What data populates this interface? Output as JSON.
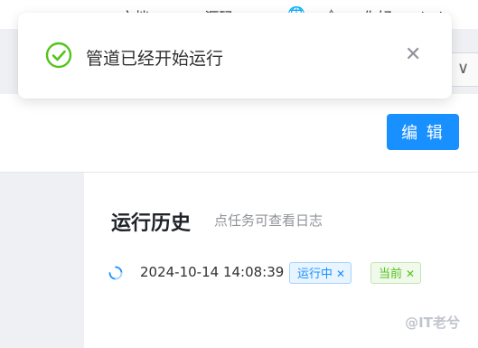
{
  "header": {
    "nav_doc": "文档",
    "nav_src": "源码",
    "nav_user": "你好，admin"
  },
  "toolbar": {
    "edit_label": "编 辑"
  },
  "history": {
    "title": "运行历史",
    "hint": "点任务可查看日志",
    "runs": [
      {
        "time": "2024-10-14 14:08:39",
        "status_tag": "运行中",
        "current_tag": "当前"
      }
    ]
  },
  "notification": {
    "message": "管道已经开始运行"
  },
  "watermark": "@IT老兮",
  "colors": {
    "primary": "#1890ff",
    "success": "#52c41a",
    "panel_bg": "#eef0f4"
  },
  "icons": {
    "toast": "check-circle-icon",
    "run_status": "loading-spinner-icon"
  }
}
